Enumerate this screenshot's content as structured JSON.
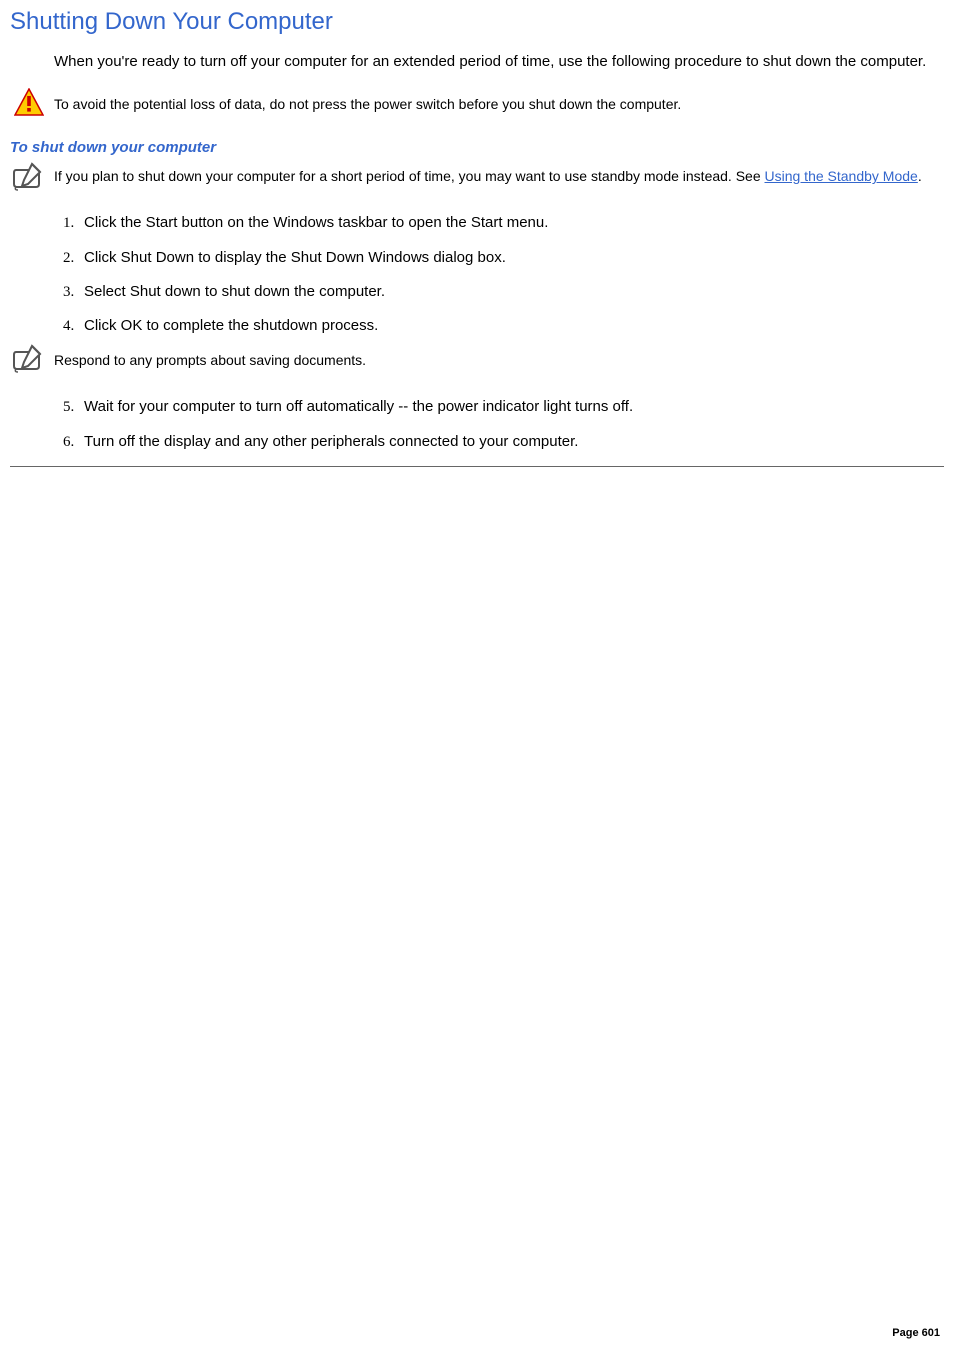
{
  "title": "Shutting Down Your Computer",
  "intro": "When you're ready to turn off your computer for an extended period of time, use the following procedure to shut down the computer.",
  "warning": "To avoid the potential loss of data, do not press the power switch before you shut down the computer.",
  "sub_heading": "To shut down your computer",
  "note1_part1": " If you plan to shut down your computer for a short period of time, you may want to use standby mode instead. See ",
  "note1_link": "Using the Standby Mode",
  "note1_part2": ".",
  "steps_a": [
    "Click the Start button on the Windows taskbar to open the Start menu.",
    "Click Shut Down to display the Shut Down Windows dialog box.",
    "Select Shut down to shut down the computer.",
    "Click OK to complete the shutdown process."
  ],
  "note2": " Respond to any prompts about saving documents.",
  "steps_b": [
    "Wait for your computer to turn off automatically -- the power indicator light turns off.",
    "Turn off the display and any other peripherals connected to your computer."
  ],
  "page_number": "Page 601"
}
